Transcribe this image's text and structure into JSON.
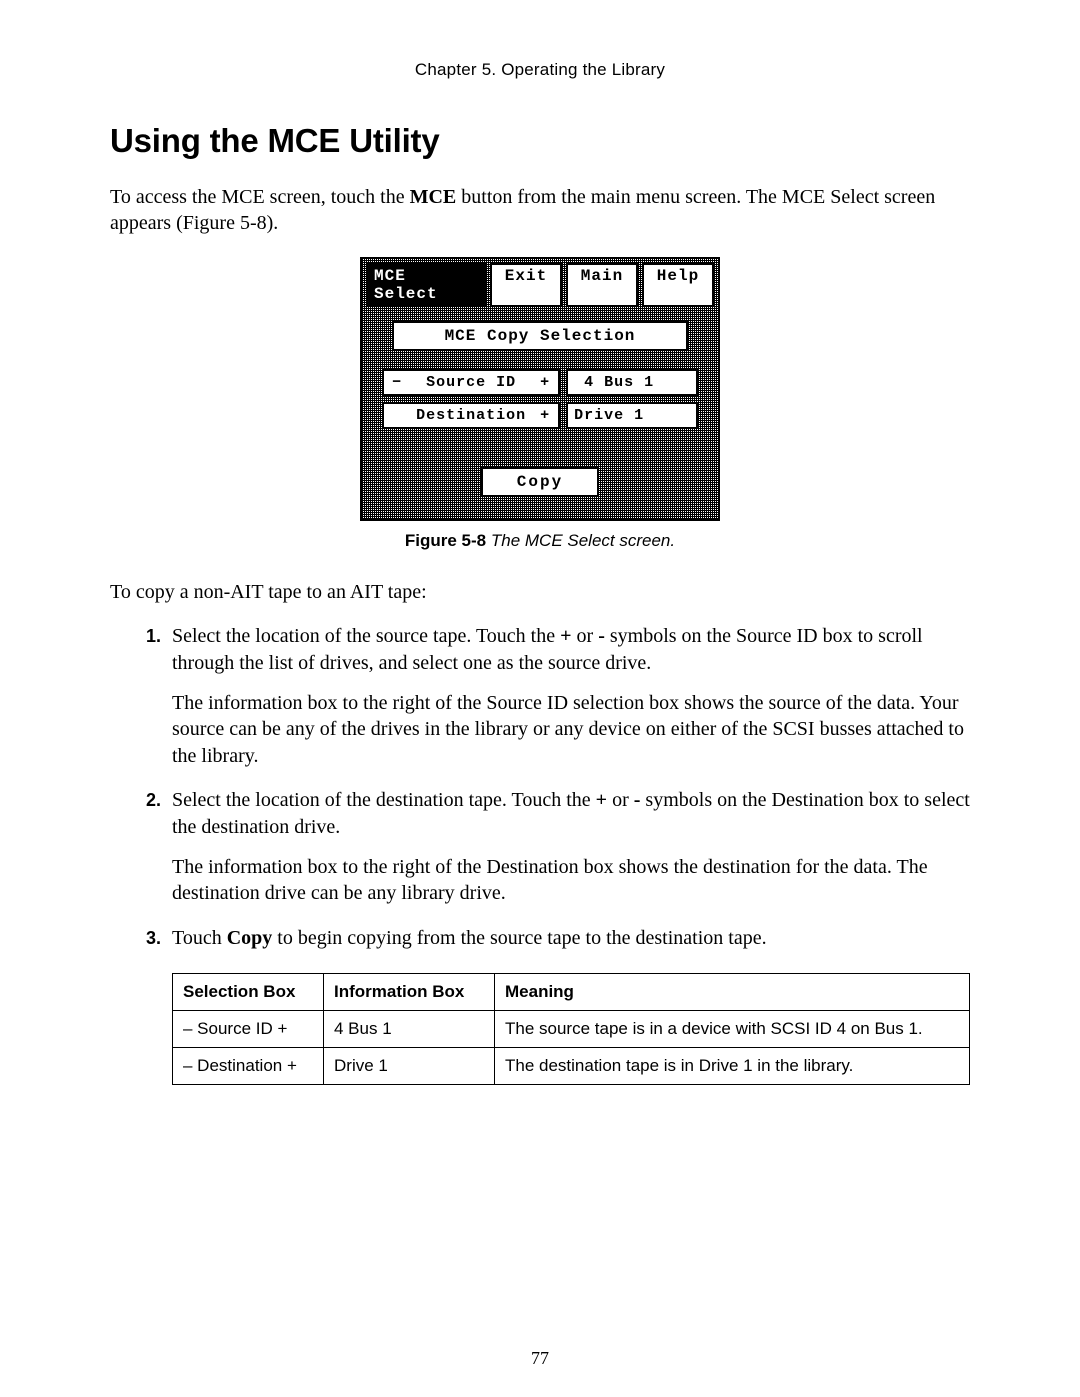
{
  "header": {
    "chapter": "Chapter 5.  Operating the Library"
  },
  "title": "Using the MCE Utility",
  "intro": {
    "pre": "To access the MCE screen, touch the ",
    "btn": "MCE",
    "post": " button from the main menu screen. The MCE Select screen appears (Figure 5-8)."
  },
  "mce": {
    "title": "MCE Select",
    "exit": "Exit",
    "main": "Main",
    "help": "Help",
    "section": "MCE Copy Selection",
    "source": {
      "minus": "−",
      "label": "Source ID",
      "plus": "+",
      "value": " 4 Bus 1"
    },
    "dest": {
      "minus": " ",
      "label": "Destination",
      "plus": "+",
      "value": "Drive 1"
    },
    "copy": "Copy"
  },
  "figure": {
    "label": "Figure 5-8",
    "desc": "   The MCE Select screen."
  },
  "lead": "To copy a non-AIT tape to an AIT tape:",
  "steps": {
    "s1": {
      "pre": "Select the location of the source tape. Touch the ",
      "plus": "+",
      "mid": " or ",
      "minus": "-",
      "post": " symbols on the Source ID box to scroll through the list of drives, and select one as the source drive.",
      "p2": "The information box to the right of the Source ID selection box shows the source of the data. Your source can be any of the drives in the library or any device on either of the SCSI busses attached to the library."
    },
    "s2": {
      "pre": "Select the location of the destination tape. Touch the ",
      "plus": "+",
      "mid": " or ",
      "minus": "-",
      "post": " symbols on the Destination box to select the destination drive.",
      "p2": "The information box to the right of the Destination box shows the destination for the data. The destination drive can be any library drive."
    },
    "s3": {
      "pre": "Touch ",
      "copy": "Copy",
      "post": " to begin copying from the source tape to the destination tape."
    }
  },
  "table": {
    "headers": {
      "sel": "Selection Box",
      "info": "Information Box",
      "mean": "Meaning"
    },
    "rows": [
      {
        "sel": "– Source ID +",
        "info": "4 Bus 1",
        "mean": "The source tape is in a device with SCSI ID 4 on Bus 1."
      },
      {
        "sel": "– Destination +",
        "info": "Drive 1",
        "mean": "The destination tape is in Drive 1 in the library."
      }
    ]
  },
  "page_number": "77"
}
